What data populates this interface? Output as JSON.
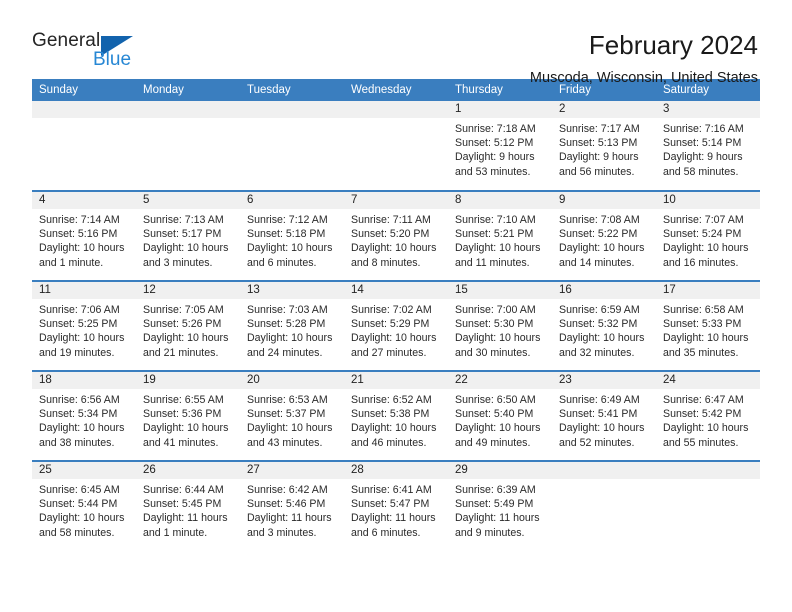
{
  "brand": {
    "name_part1": "General",
    "name_part2": "Blue",
    "accent_color": "#1263ad",
    "link_color": "#2787d4"
  },
  "header": {
    "title": "February 2024",
    "subtitle": "Muscoda, Wisconsin, United States"
  },
  "theme": {
    "header_bg": "#3a7ebf",
    "daynum_bg": "#f0f0f0",
    "cell_bg": "#ffffff",
    "text_color": "#2a2a2a"
  },
  "weekdays": [
    "Sunday",
    "Monday",
    "Tuesday",
    "Wednesday",
    "Thursday",
    "Friday",
    "Saturday"
  ],
  "labels": {
    "sunrise_prefix": "Sunrise:",
    "sunset_prefix": "Sunset:",
    "daylight_prefix": "Daylight:"
  },
  "weeks": [
    [
      {
        "day": "",
        "sunrise": "",
        "sunset": "",
        "daylight_line1": "",
        "daylight_line2": "",
        "empty": true
      },
      {
        "day": "",
        "sunrise": "",
        "sunset": "",
        "daylight_line1": "",
        "daylight_line2": "",
        "empty": true
      },
      {
        "day": "",
        "sunrise": "",
        "sunset": "",
        "daylight_line1": "",
        "daylight_line2": "",
        "empty": true
      },
      {
        "day": "",
        "sunrise": "",
        "sunset": "",
        "daylight_line1": "",
        "daylight_line2": "",
        "empty": true
      },
      {
        "day": "1",
        "sunrise": "Sunrise: 7:18 AM",
        "sunset": "Sunset: 5:12 PM",
        "daylight_line1": "Daylight: 9 hours",
        "daylight_line2": "and 53 minutes.",
        "empty": false
      },
      {
        "day": "2",
        "sunrise": "Sunrise: 7:17 AM",
        "sunset": "Sunset: 5:13 PM",
        "daylight_line1": "Daylight: 9 hours",
        "daylight_line2": "and 56 minutes.",
        "empty": false
      },
      {
        "day": "3",
        "sunrise": "Sunrise: 7:16 AM",
        "sunset": "Sunset: 5:14 PM",
        "daylight_line1": "Daylight: 9 hours",
        "daylight_line2": "and 58 minutes.",
        "empty": false
      }
    ],
    [
      {
        "day": "4",
        "sunrise": "Sunrise: 7:14 AM",
        "sunset": "Sunset: 5:16 PM",
        "daylight_line1": "Daylight: 10 hours",
        "daylight_line2": "and 1 minute.",
        "empty": false
      },
      {
        "day": "5",
        "sunrise": "Sunrise: 7:13 AM",
        "sunset": "Sunset: 5:17 PM",
        "daylight_line1": "Daylight: 10 hours",
        "daylight_line2": "and 3 minutes.",
        "empty": false
      },
      {
        "day": "6",
        "sunrise": "Sunrise: 7:12 AM",
        "sunset": "Sunset: 5:18 PM",
        "daylight_line1": "Daylight: 10 hours",
        "daylight_line2": "and 6 minutes.",
        "empty": false
      },
      {
        "day": "7",
        "sunrise": "Sunrise: 7:11 AM",
        "sunset": "Sunset: 5:20 PM",
        "daylight_line1": "Daylight: 10 hours",
        "daylight_line2": "and 8 minutes.",
        "empty": false
      },
      {
        "day": "8",
        "sunrise": "Sunrise: 7:10 AM",
        "sunset": "Sunset: 5:21 PM",
        "daylight_line1": "Daylight: 10 hours",
        "daylight_line2": "and 11 minutes.",
        "empty": false
      },
      {
        "day": "9",
        "sunrise": "Sunrise: 7:08 AM",
        "sunset": "Sunset: 5:22 PM",
        "daylight_line1": "Daylight: 10 hours",
        "daylight_line2": "and 14 minutes.",
        "empty": false
      },
      {
        "day": "10",
        "sunrise": "Sunrise: 7:07 AM",
        "sunset": "Sunset: 5:24 PM",
        "daylight_line1": "Daylight: 10 hours",
        "daylight_line2": "and 16 minutes.",
        "empty": false
      }
    ],
    [
      {
        "day": "11",
        "sunrise": "Sunrise: 7:06 AM",
        "sunset": "Sunset: 5:25 PM",
        "daylight_line1": "Daylight: 10 hours",
        "daylight_line2": "and 19 minutes.",
        "empty": false
      },
      {
        "day": "12",
        "sunrise": "Sunrise: 7:05 AM",
        "sunset": "Sunset: 5:26 PM",
        "daylight_line1": "Daylight: 10 hours",
        "daylight_line2": "and 21 minutes.",
        "empty": false
      },
      {
        "day": "13",
        "sunrise": "Sunrise: 7:03 AM",
        "sunset": "Sunset: 5:28 PM",
        "daylight_line1": "Daylight: 10 hours",
        "daylight_line2": "and 24 minutes.",
        "empty": false
      },
      {
        "day": "14",
        "sunrise": "Sunrise: 7:02 AM",
        "sunset": "Sunset: 5:29 PM",
        "daylight_line1": "Daylight: 10 hours",
        "daylight_line2": "and 27 minutes.",
        "empty": false
      },
      {
        "day": "15",
        "sunrise": "Sunrise: 7:00 AM",
        "sunset": "Sunset: 5:30 PM",
        "daylight_line1": "Daylight: 10 hours",
        "daylight_line2": "and 30 minutes.",
        "empty": false
      },
      {
        "day": "16",
        "sunrise": "Sunrise: 6:59 AM",
        "sunset": "Sunset: 5:32 PM",
        "daylight_line1": "Daylight: 10 hours",
        "daylight_line2": "and 32 minutes.",
        "empty": false
      },
      {
        "day": "17",
        "sunrise": "Sunrise: 6:58 AM",
        "sunset": "Sunset: 5:33 PM",
        "daylight_line1": "Daylight: 10 hours",
        "daylight_line2": "and 35 minutes.",
        "empty": false
      }
    ],
    [
      {
        "day": "18",
        "sunrise": "Sunrise: 6:56 AM",
        "sunset": "Sunset: 5:34 PM",
        "daylight_line1": "Daylight: 10 hours",
        "daylight_line2": "and 38 minutes.",
        "empty": false
      },
      {
        "day": "19",
        "sunrise": "Sunrise: 6:55 AM",
        "sunset": "Sunset: 5:36 PM",
        "daylight_line1": "Daylight: 10 hours",
        "daylight_line2": "and 41 minutes.",
        "empty": false
      },
      {
        "day": "20",
        "sunrise": "Sunrise: 6:53 AM",
        "sunset": "Sunset: 5:37 PM",
        "daylight_line1": "Daylight: 10 hours",
        "daylight_line2": "and 43 minutes.",
        "empty": false
      },
      {
        "day": "21",
        "sunrise": "Sunrise: 6:52 AM",
        "sunset": "Sunset: 5:38 PM",
        "daylight_line1": "Daylight: 10 hours",
        "daylight_line2": "and 46 minutes.",
        "empty": false
      },
      {
        "day": "22",
        "sunrise": "Sunrise: 6:50 AM",
        "sunset": "Sunset: 5:40 PM",
        "daylight_line1": "Daylight: 10 hours",
        "daylight_line2": "and 49 minutes.",
        "empty": false
      },
      {
        "day": "23",
        "sunrise": "Sunrise: 6:49 AM",
        "sunset": "Sunset: 5:41 PM",
        "daylight_line1": "Daylight: 10 hours",
        "daylight_line2": "and 52 minutes.",
        "empty": false
      },
      {
        "day": "24",
        "sunrise": "Sunrise: 6:47 AM",
        "sunset": "Sunset: 5:42 PM",
        "daylight_line1": "Daylight: 10 hours",
        "daylight_line2": "and 55 minutes.",
        "empty": false
      }
    ],
    [
      {
        "day": "25",
        "sunrise": "Sunrise: 6:45 AM",
        "sunset": "Sunset: 5:44 PM",
        "daylight_line1": "Daylight: 10 hours",
        "daylight_line2": "and 58 minutes.",
        "empty": false
      },
      {
        "day": "26",
        "sunrise": "Sunrise: 6:44 AM",
        "sunset": "Sunset: 5:45 PM",
        "daylight_line1": "Daylight: 11 hours",
        "daylight_line2": "and 1 minute.",
        "empty": false
      },
      {
        "day": "27",
        "sunrise": "Sunrise: 6:42 AM",
        "sunset": "Sunset: 5:46 PM",
        "daylight_line1": "Daylight: 11 hours",
        "daylight_line2": "and 3 minutes.",
        "empty": false
      },
      {
        "day": "28",
        "sunrise": "Sunrise: 6:41 AM",
        "sunset": "Sunset: 5:47 PM",
        "daylight_line1": "Daylight: 11 hours",
        "daylight_line2": "and 6 minutes.",
        "empty": false
      },
      {
        "day": "29",
        "sunrise": "Sunrise: 6:39 AM",
        "sunset": "Sunset: 5:49 PM",
        "daylight_line1": "Daylight: 11 hours",
        "daylight_line2": "and 9 minutes.",
        "empty": false
      },
      {
        "day": "",
        "sunrise": "",
        "sunset": "",
        "daylight_line1": "",
        "daylight_line2": "",
        "empty": true
      },
      {
        "day": "",
        "sunrise": "",
        "sunset": "",
        "daylight_line1": "",
        "daylight_line2": "",
        "empty": true
      }
    ]
  ]
}
